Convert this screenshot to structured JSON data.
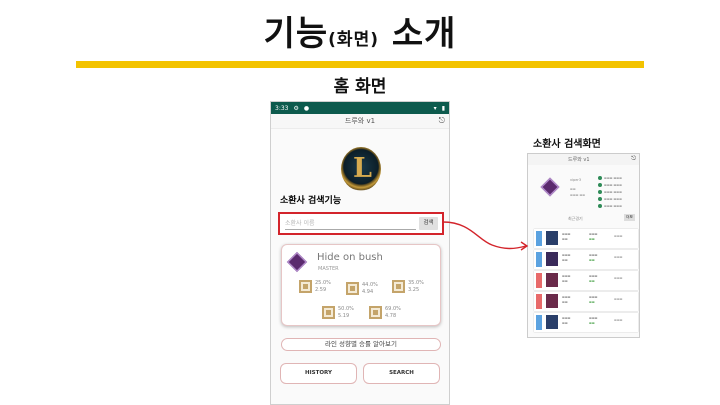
{
  "slide": {
    "title_main": "기능",
    "title_paren": "(화면)",
    "title_tail": "소개",
    "section_label": "홈 화면",
    "search_callout": "소환사 검색기능",
    "preview_label": "소환사 검색화면",
    "accent_color": "#f3c300",
    "highlight_color": "#d3242b"
  },
  "phone": {
    "status_time": "3:33",
    "app_title": "드루와 v1",
    "logout_icon": "logout-icon",
    "search": {
      "placeholder": "소환사 이름",
      "button_label": "검색"
    },
    "summoner": {
      "name": "Hide on bush",
      "tier": "MASTER",
      "lanes": [
        {
          "icon": "top-lane-icon",
          "pct": "25.0%",
          "kda": "2.59"
        },
        {
          "icon": "jungle-lane-icon",
          "pct": "44.0%",
          "kda": "4.94"
        },
        {
          "icon": "mid-lane-icon",
          "pct": "35.0%",
          "kda": "3.25"
        },
        {
          "icon": "bot-lane-icon",
          "pct": "50.0%",
          "kda": "5.19"
        },
        {
          "icon": "support-lane-icon",
          "pct": "69.0%",
          "kda": "4.78"
        }
      ]
    },
    "lane_button_label": "라인 성향별 승률 알아보기",
    "history_button_label": "HISTORY",
    "search_button_label": "SEARCH"
  },
  "preview": {
    "app_title": "드루와 v1",
    "name": "viper3",
    "recent_label": "최근경기",
    "more_label": "더보"
  }
}
